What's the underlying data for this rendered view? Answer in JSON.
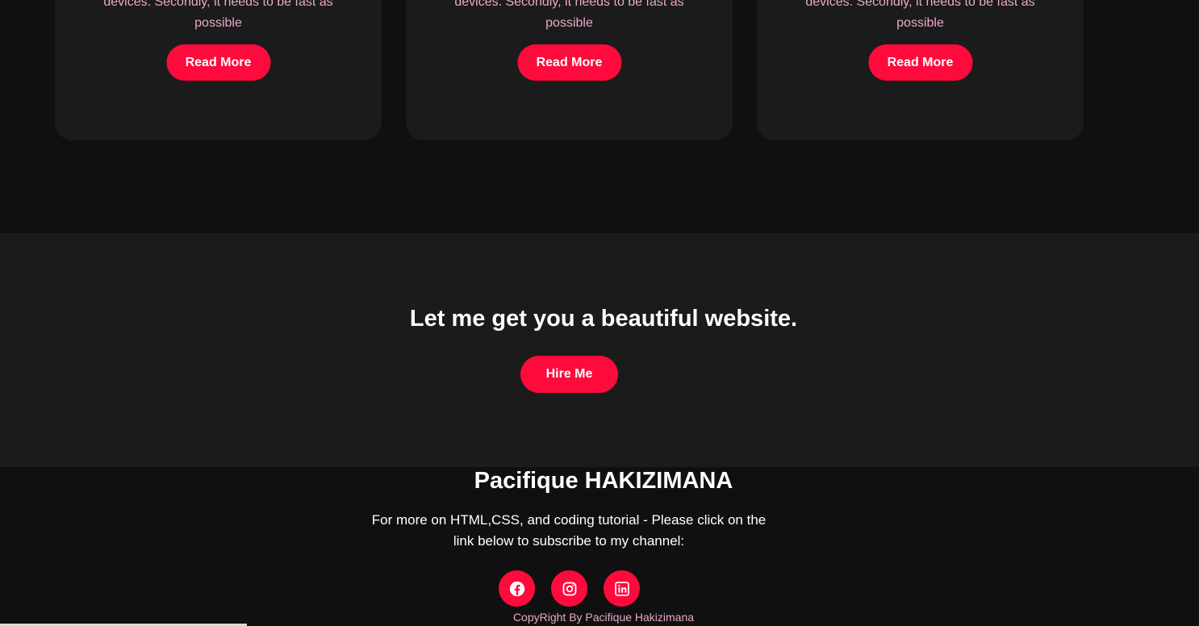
{
  "services": {
    "cards": [
      {
        "desc_line1": "devices. Secondly, it needs to be fast as",
        "desc_line2": "possible",
        "button": "Read More"
      },
      {
        "desc_line1": "devices. Secondly, it needs to be fast as",
        "desc_line2": "possible",
        "button": "Read More"
      },
      {
        "desc_line1": "devices. Secondly, it needs to be fast as",
        "desc_line2": "possible",
        "button": "Read More"
      }
    ]
  },
  "cta": {
    "heading": "Let me get you a beautiful website.",
    "button": "Hire Me"
  },
  "footer": {
    "name": "Pacifique HAKIZIMANA",
    "text_line1": "For more on HTML,CSS, and coding tutorial - Please click on the",
    "text_line2": "link below to subscribe to my channel:",
    "socials": [
      "facebook-icon",
      "instagram-icon",
      "linkedin-icon"
    ],
    "copyright": "CopyRight By Pacifique Hakizimana"
  },
  "colors": {
    "accent": "#ff0a3c",
    "background": "#101010",
    "card": "#1b1b1b",
    "muted_text": "#e8a9cb"
  }
}
